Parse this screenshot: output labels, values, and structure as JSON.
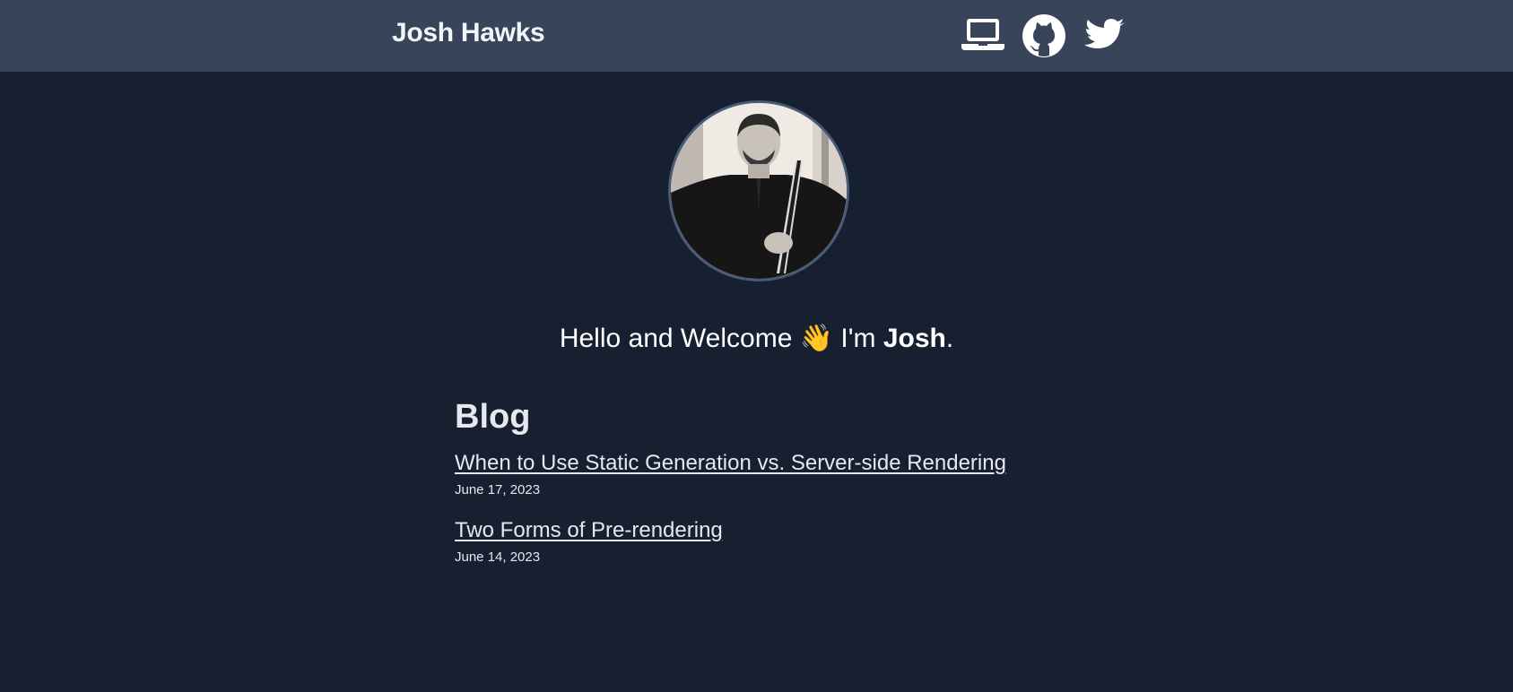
{
  "header": {
    "site_title": "Josh Hawks",
    "icons": [
      "laptop-icon",
      "github-icon",
      "twitter-icon"
    ]
  },
  "hero": {
    "greeting_prefix": "Hello and Welcome ",
    "wave_emoji": "👋",
    "greeting_middle": " I'm ",
    "greeting_name": "Josh",
    "greeting_suffix": "."
  },
  "blog": {
    "heading": "Blog",
    "posts": [
      {
        "title": "When to Use Static Generation vs. Server-side Rendering",
        "date": "June 17, 2023"
      },
      {
        "title": "Two Forms of Pre-rendering",
        "date": "June 14, 2023"
      }
    ]
  },
  "colors": {
    "page_background": "#172030",
    "header_background": "#374459",
    "avatar_border": "#4a5b77",
    "text": "#ffffff"
  }
}
